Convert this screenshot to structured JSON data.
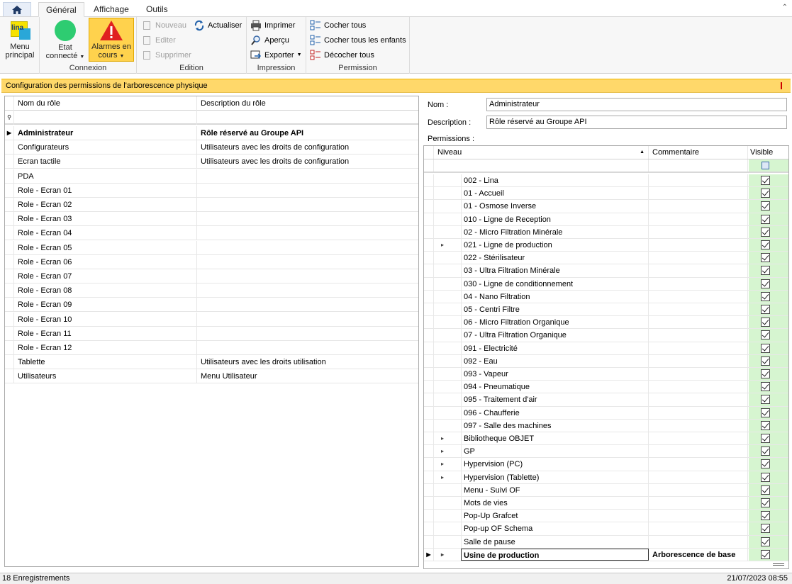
{
  "tabs": [
    {
      "label": "Général",
      "active": true
    },
    {
      "label": "Affichage",
      "active": false
    },
    {
      "label": "Outils",
      "active": false
    }
  ],
  "ribbon": {
    "menu_principal": {
      "icon_text": "lina",
      "label_line1": "Menu",
      "label_line2": "principal"
    },
    "connexion": {
      "group_label": "Connexion",
      "etat_line1": "Etat",
      "etat_line2": "connecté",
      "alarmes_line1": "Alarmes en",
      "alarmes_line2": "cours"
    },
    "edition": {
      "group_label": "Edition",
      "nouveau": "Nouveau",
      "editer": "Editer",
      "supprimer": "Supprimer",
      "actualiser": "Actualiser"
    },
    "impression": {
      "group_label": "Impression",
      "imprimer": "Imprimer",
      "apercu": "Aperçu",
      "exporter": "Exporter"
    },
    "permission": {
      "group_label": "Permission",
      "cocher_tous": "Cocher tous",
      "cocher_enfants": "Cocher tous les enfants",
      "decocher_tous": "Décocher tous"
    }
  },
  "title_bar": "Configuration des permissions de l'arborescence physique",
  "roles_grid": {
    "headers": [
      "Nom du rôle",
      "Description du rôle"
    ],
    "rows": [
      {
        "name": "Administrateur",
        "desc": "Rôle réservé au Groupe API",
        "selected": true
      },
      {
        "name": "Configurateurs",
        "desc": "Utilisateurs avec les droits de configuration"
      },
      {
        "name": "Ecran tactile",
        "desc": "Utilisateurs avec les droits de configuration"
      },
      {
        "name": "PDA",
        "desc": ""
      },
      {
        "name": "Role - Ecran 01",
        "desc": ""
      },
      {
        "name": "Role - Ecran 02",
        "desc": ""
      },
      {
        "name": "Role - Ecran 03",
        "desc": ""
      },
      {
        "name": "Role - Ecran 04",
        "desc": ""
      },
      {
        "name": "Role - Ecran 05",
        "desc": ""
      },
      {
        "name": "Role - Ecran 06",
        "desc": ""
      },
      {
        "name": "Role - Ecran 07",
        "desc": ""
      },
      {
        "name": "Role - Ecran 08",
        "desc": ""
      },
      {
        "name": "Role - Ecran 09",
        "desc": ""
      },
      {
        "name": "Role - Ecran 10",
        "desc": ""
      },
      {
        "name": "Role - Ecran 11",
        "desc": ""
      },
      {
        "name": "Role - Ecran 12",
        "desc": ""
      },
      {
        "name": "Tablette",
        "desc": "Utilisateurs avec les droits utilisation"
      },
      {
        "name": "Utilisateurs",
        "desc": "Menu Utilisateur"
      }
    ]
  },
  "detail": {
    "nom_label": "Nom :",
    "nom_value": "Administrateur",
    "description_label": "Description :",
    "description_value": "Rôle réservé au Groupe API",
    "permissions_label": "Permissions :"
  },
  "perm_grid": {
    "headers": {
      "niveau": "Niveau",
      "commentaire": "Commentaire",
      "visible": "Visible"
    },
    "rows": [
      {
        "niveau": "002 - Lina",
        "commentaire": "",
        "expand": false
      },
      {
        "niveau": "01 - Accueil",
        "commentaire": "",
        "expand": false
      },
      {
        "niveau": "01 - Osmose Inverse",
        "commentaire": "",
        "expand": false
      },
      {
        "niveau": "010 - Ligne de Reception",
        "commentaire": "",
        "expand": false
      },
      {
        "niveau": "02 - Micro Filtration Minérale",
        "commentaire": "",
        "expand": false
      },
      {
        "niveau": "021 - Ligne de production",
        "commentaire": "",
        "expand": true
      },
      {
        "niveau": "022 - Stérilisateur",
        "commentaire": "",
        "expand": false
      },
      {
        "niveau": "03 - Ultra Filtration Minérale",
        "commentaire": "",
        "expand": false
      },
      {
        "niveau": "030 - Ligne de conditionnement",
        "commentaire": "",
        "expand": false
      },
      {
        "niveau": "04 - Nano Filtration",
        "commentaire": "",
        "expand": false
      },
      {
        "niveau": "05 - Centri Filtre",
        "commentaire": "",
        "expand": false
      },
      {
        "niveau": "06 - Micro Filtration Organique",
        "commentaire": "",
        "expand": false
      },
      {
        "niveau": "07 - Ultra Filtration Organique",
        "commentaire": "",
        "expand": false
      },
      {
        "niveau": "091 - Electricité",
        "commentaire": "",
        "expand": false
      },
      {
        "niveau": "092 - Eau",
        "commentaire": "",
        "expand": false
      },
      {
        "niveau": "093 - Vapeur",
        "commentaire": "",
        "expand": false
      },
      {
        "niveau": "094 - Pneumatique",
        "commentaire": "",
        "expand": false
      },
      {
        "niveau": "095 - Traitement d'air",
        "commentaire": "",
        "expand": false
      },
      {
        "niveau": "096 - Chaufferie",
        "commentaire": "",
        "expand": false
      },
      {
        "niveau": "097 - Salle des machines",
        "commentaire": "",
        "expand": false
      },
      {
        "niveau": "Bibliotheque OBJET",
        "commentaire": "",
        "expand": true
      },
      {
        "niveau": "GP",
        "commentaire": "",
        "expand": true
      },
      {
        "niveau": "Hypervision (PC)",
        "commentaire": "",
        "expand": true
      },
      {
        "niveau": "Hypervision (Tablette)",
        "commentaire": "",
        "expand": true
      },
      {
        "niveau": "Menu - Suivi OF",
        "commentaire": "",
        "expand": false
      },
      {
        "niveau": "Mots de vies",
        "commentaire": "",
        "expand": false
      },
      {
        "niveau": "Pop-Up Grafcet",
        "commentaire": "",
        "expand": false
      },
      {
        "niveau": "Pop-up OF Schema",
        "commentaire": "",
        "expand": false
      },
      {
        "niveau": "Salle de pause",
        "commentaire": "",
        "expand": false
      },
      {
        "niveau": "Usine de production",
        "commentaire": "Arborescence de base",
        "expand": true,
        "selected": true
      }
    ]
  },
  "status": {
    "records": "18 Enregistrements",
    "datetime": "21/07/2023 08:55"
  },
  "colors": {
    "title_bar": "#ffd86a",
    "alarm_button": "#ffd24d",
    "status_ok": "#2ecc71",
    "alarm_icon": "#e02020",
    "visible_column": "#d6f5d0"
  }
}
